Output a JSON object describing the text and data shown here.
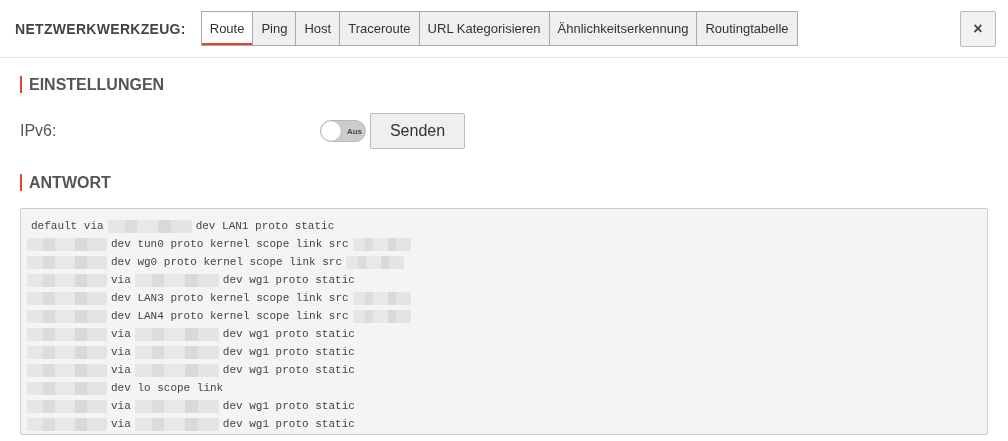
{
  "header": {
    "title": "NETZWERKWERKZEUG:",
    "tabs": [
      {
        "label": "Route",
        "selected": true
      },
      {
        "label": "Ping",
        "selected": false
      },
      {
        "label": "Host",
        "selected": false
      },
      {
        "label": "Traceroute",
        "selected": false
      },
      {
        "label": "URL Kategorisieren",
        "selected": false
      },
      {
        "label": "Ähnlichkeitserkennung",
        "selected": false
      },
      {
        "label": "Routingtabelle",
        "selected": false
      }
    ],
    "close": "×"
  },
  "settings": {
    "heading": "EINSTELLUNGEN",
    "ipv6": {
      "label": "IPv6:",
      "on": false,
      "state_label": "Aus"
    },
    "send_button": "Senden"
  },
  "response": {
    "heading": "ANTWORT",
    "lines": [
      [
        {
          "kind": "text",
          "text": "default via"
        },
        {
          "kind": "redacted"
        },
        {
          "kind": "text",
          "text": "dev LAN1 proto static"
        }
      ],
      [
        {
          "kind": "redacted"
        },
        {
          "kind": "text",
          "text": "dev tun0 proto kernel scope link src"
        },
        {
          "kind": "redacted"
        }
      ],
      [
        {
          "kind": "redacted"
        },
        {
          "kind": "text",
          "text": "dev wg0 proto kernel scope link src"
        },
        {
          "kind": "redacted"
        }
      ],
      [
        {
          "kind": "redacted"
        },
        {
          "kind": "text",
          "text": "via"
        },
        {
          "kind": "redacted"
        },
        {
          "kind": "text",
          "text": "dev wg1 proto static"
        }
      ],
      [
        {
          "kind": "redacted"
        },
        {
          "kind": "text",
          "text": "dev LAN3 proto kernel scope link src"
        },
        {
          "kind": "redacted"
        }
      ],
      [
        {
          "kind": "redacted"
        },
        {
          "kind": "text",
          "text": "dev LAN4 proto kernel scope link src"
        },
        {
          "kind": "redacted"
        }
      ],
      [
        {
          "kind": "redacted"
        },
        {
          "kind": "text",
          "text": "via"
        },
        {
          "kind": "redacted"
        },
        {
          "kind": "text",
          "text": "dev wg1 proto static"
        }
      ],
      [
        {
          "kind": "redacted"
        },
        {
          "kind": "text",
          "text": "via"
        },
        {
          "kind": "redacted"
        },
        {
          "kind": "text",
          "text": "dev wg1 proto static"
        }
      ],
      [
        {
          "kind": "redacted"
        },
        {
          "kind": "text",
          "text": "via"
        },
        {
          "kind": "redacted"
        },
        {
          "kind": "text",
          "text": "dev wg1 proto static"
        }
      ],
      [
        {
          "kind": "redacted"
        },
        {
          "kind": "text",
          "text": "dev lo scope link"
        }
      ],
      [
        {
          "kind": "redacted"
        },
        {
          "kind": "text",
          "text": "via"
        },
        {
          "kind": "redacted"
        },
        {
          "kind": "text",
          "text": "dev wg1 proto static"
        }
      ],
      [
        {
          "kind": "redacted"
        },
        {
          "kind": "text",
          "text": "via"
        },
        {
          "kind": "redacted"
        },
        {
          "kind": "text",
          "text": "dev wg1 proto static"
        }
      ]
    ]
  }
}
